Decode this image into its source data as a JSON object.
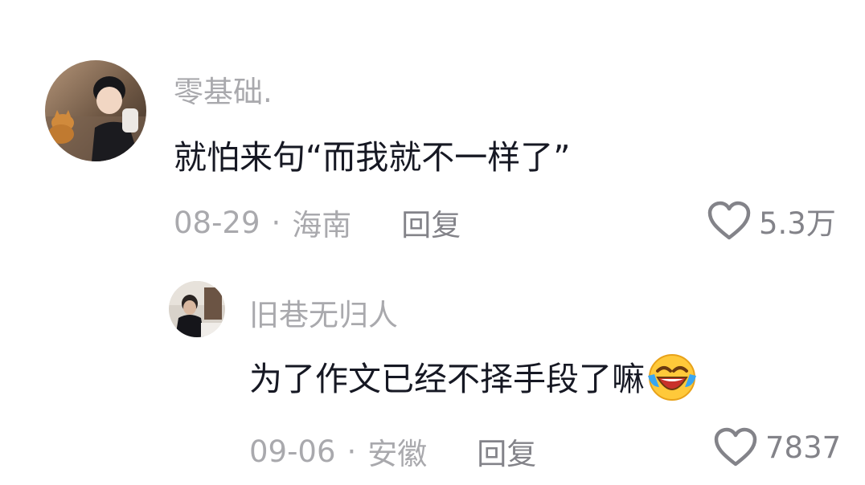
{
  "comments": [
    {
      "username": "零基础.",
      "text": "就怕来句“而我就不一样了”",
      "date": "08-29",
      "separator": "·",
      "location": "海南",
      "reply_label": "回复",
      "likes": "5.3万",
      "avatar": "avatar-boy-with-cat"
    },
    {
      "username": "旧巷无归人",
      "text": "为了作文已经不择手段了嘛",
      "emoji": "laughing-crying-emoji",
      "date": "09-06",
      "separator": "·",
      "location": "安徽",
      "reply_label": "回复",
      "likes": "7837",
      "avatar": "avatar-person-dark-room"
    }
  ],
  "colors": {
    "username": "#a9a9ad",
    "text": "#161823",
    "meta": "#a9a9ad",
    "action": "#838389"
  },
  "icons": {
    "like": "heart-outline-icon"
  }
}
